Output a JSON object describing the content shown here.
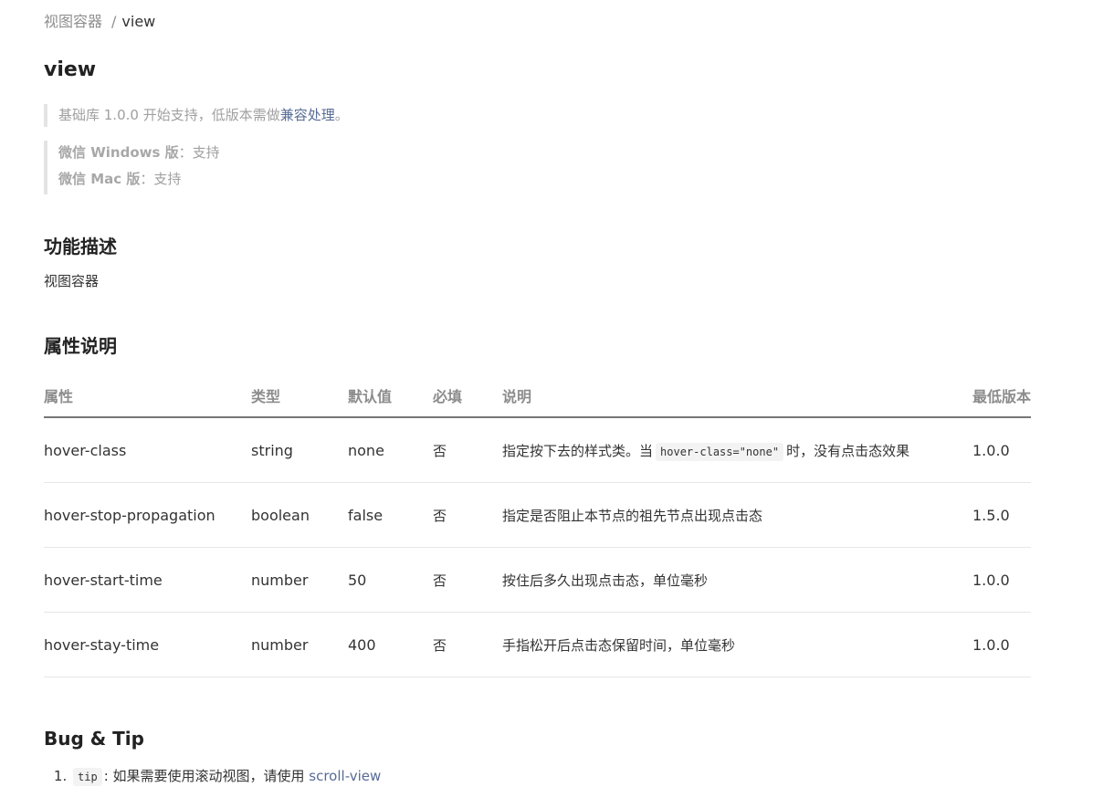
{
  "breadcrumb": {
    "parent": "视图容器",
    "separator": "/",
    "current": "view"
  },
  "title": "view",
  "support_note": {
    "prefix": "基础库 1.0.0 开始支持，低版本需做",
    "link": "兼容处理",
    "suffix": "。"
  },
  "platforms": [
    {
      "name": "微信 Windows 版",
      "sep": "：",
      "status": "支持"
    },
    {
      "name": "微信 Mac 版",
      "sep": "：",
      "status": "支持"
    }
  ],
  "section_description": {
    "heading": "功能描述",
    "text": "视图容器"
  },
  "section_attributes": {
    "heading": "属性说明",
    "columns": [
      "属性",
      "类型",
      "默认值",
      "必填",
      "说明",
      "最低版本"
    ],
    "rows": [
      {
        "name": "hover-class",
        "type": "string",
        "default": "none",
        "required": "否",
        "desc_prefix": "指定按下去的样式类。当",
        "desc_code": "hover-class=\"none\"",
        "desc_suffix": "时，没有点击态效果",
        "version": "1.0.0"
      },
      {
        "name": "hover-stop-propagation",
        "type": "boolean",
        "default": "false",
        "required": "否",
        "desc": "指定是否阻止本节点的祖先节点出现点击态",
        "version": "1.5.0"
      },
      {
        "name": "hover-start-time",
        "type": "number",
        "default": "50",
        "required": "否",
        "desc": "按住后多久出现点击态，单位毫秒",
        "version": "1.0.0"
      },
      {
        "name": "hover-stay-time",
        "type": "number",
        "default": "400",
        "required": "否",
        "desc": "手指松开后点击态保留时间，单位毫秒",
        "version": "1.0.0"
      }
    ]
  },
  "section_bug": {
    "heading": "Bug & Tip",
    "tips": [
      {
        "code": "tip",
        "text": ": 如果需要使用滚动视图，请使用 ",
        "link": "scroll-view"
      }
    ]
  },
  "colors": {
    "link": "#576b95",
    "muted": "#8f8f8f",
    "text": "#333333"
  }
}
